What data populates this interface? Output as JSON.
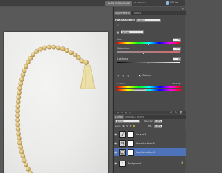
{
  "appbar": {
    "workspace_button": "BASIC WORKSPACE",
    "workspace_more": "ESSENTIALS",
    "workspace_arrows": "»",
    "cslive_label": "CS Live"
  },
  "adjustments": {
    "tabs": [
      "ADJUSTMENTS",
      "MASKS"
    ],
    "title": "Hue/Saturation",
    "preset": "Custom",
    "channel": "Yellows",
    "hue": {
      "label": "Hue:",
      "value": "0"
    },
    "saturation": {
      "label": "Saturation:",
      "value": "-17"
    },
    "lightness": {
      "label": "Lightness:",
      "value": "0"
    },
    "colorize_label": "Colorize",
    "range_left": "15°/45°",
    "range_right": "75°\\105°",
    "levels": {
      "hue": 0.5,
      "saturation": 0.42,
      "lightness": 0.5
    }
  },
  "layers_panel": {
    "tabs": [
      "LAYERS",
      "CHANNELS",
      "PATHS"
    ],
    "blend_mode": "Normal",
    "opacity_label": "Opacity:",
    "opacity_value": "100%",
    "lock_label": "Lock:",
    "fill_label": "Fill:",
    "fill_value": "100%",
    "layers": [
      {
        "name": "Curves 1",
        "thumb": "curves-icon",
        "selected": false
      },
      {
        "name": "Selective Color 1",
        "thumb": "selective-color-icon",
        "selected": false
      },
      {
        "name": "Hue/Saturation 1",
        "thumb": "hue-saturation-icon",
        "selected": true
      },
      {
        "name": "Background",
        "thumb": "photo-thumbnail",
        "selected": false
      }
    ]
  },
  "colors": {
    "selected_layer": "#4f73b9",
    "panel_bg": "#4a4a4a",
    "canvas_bg": "#595959"
  }
}
